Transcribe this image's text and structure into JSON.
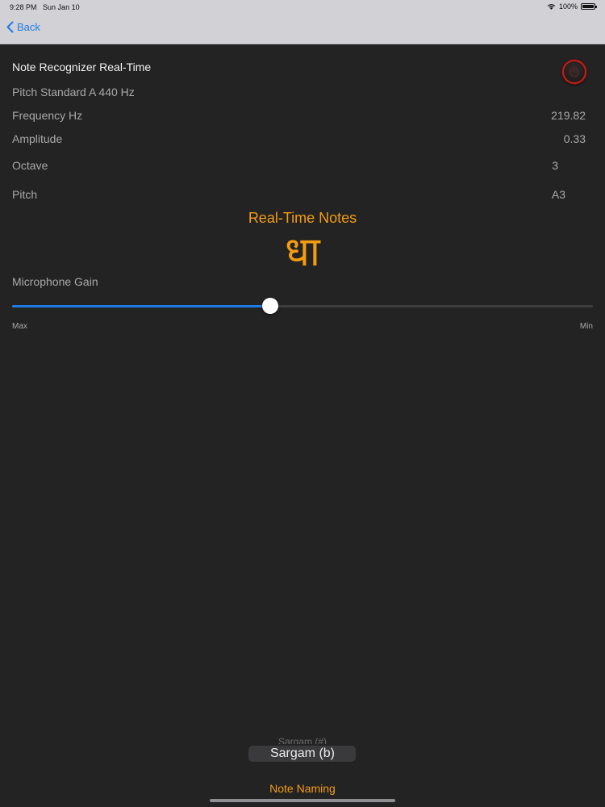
{
  "status": {
    "time": "9:28 PM",
    "date": "Sun Jan 10",
    "battery": "100%"
  },
  "nav": {
    "back_label": "Back"
  },
  "header": {
    "title": "Note Recognizer Real-Time"
  },
  "rows": {
    "pitch_standard": "Pitch Standard A 440 Hz",
    "frequency_label": "Frequency Hz",
    "frequency_value": "219.82",
    "amplitude_label": "Amplitude",
    "amplitude_value": "0.33",
    "octave_label": "Octave",
    "octave_value": "3",
    "pitch_label": "Pitch",
    "pitch_value": "A3"
  },
  "realtime": {
    "heading": "Real-Time Notes",
    "note": "धा"
  },
  "gain": {
    "label": "Microphone Gain",
    "level": 0.445,
    "left_label": "Max",
    "right_label": "Min"
  },
  "picker": {
    "options": [
      "Sargam (#)",
      "Sargam (b)"
    ],
    "selected": "Sargam (b)",
    "title": "Note Naming"
  },
  "colors": {
    "accent": "#f39c12",
    "slider_fill": "#1e7be6",
    "background": "#232323",
    "power_ring": "#c0201c"
  }
}
